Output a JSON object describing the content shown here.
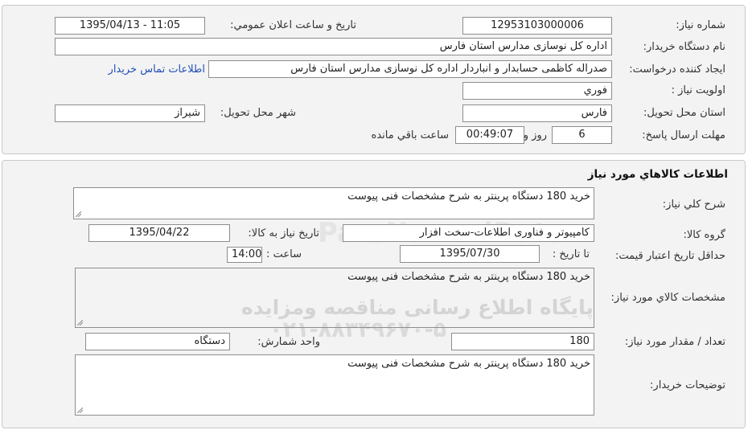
{
  "header_info": {
    "need_number_label": "شماره نياز:",
    "need_number": "12953103000006",
    "announce_datetime_label": "تاريخ و ساعت اعلان عمومي:",
    "announce_datetime": "1395/04/13 - 11:05",
    "buyer_org_label": "نام دستگاه خريدار:",
    "buyer_org": "اداره کل نوسازی مدارس استان فارس",
    "requester_label": "ايجاد کننده درخواست:",
    "requester": "صدراله  کاظمی حسابدار و انباردار اداره کل نوسازی مدارس استان فارس",
    "buyer_contact_link": "اطلاعات تماس خريدار",
    "priority_label": "اولويت نياز :",
    "priority": "فوري",
    "province_label": "استان محل تحويل:",
    "province": "فارس",
    "city_label": "شهر محل تحويل:",
    "city": "شيراز",
    "deadline_label": "مهلت ارسال پاسخ:",
    "deadline_days": "6",
    "days_and_label": "روز و",
    "deadline_time": "00:49:07",
    "remaining_label": "ساعت باقي مانده"
  },
  "goods": {
    "section_title": "اطلاعات کالاهاي مورد نياز",
    "general_desc_label": "شرح کلي نياز:",
    "general_desc": "خرید 180 دستگاه پرینتر به شرح مشخصات فنی پیوست",
    "goods_group_label": "گروه کالا:",
    "goods_group": "کامپیوتر و فناوری اطلاعات-سخت افزار",
    "need_date_label": "تاريخ نياز به کالا:",
    "need_date": "1395/04/22",
    "price_validity_label": "حداقل تاريخ اعتبار قيمت:",
    "until_date_label": "تا تاريخ :",
    "until_date": "1395/07/30",
    "time_label": "ساعت :",
    "time_value": "14:00",
    "specs_label": "مشخصات کالاي مورد نياز:",
    "specs": "خرید 180 دستگاه پرینتر به شرح مشخصات فنی پیوست",
    "quantity_label": "تعداد / مقدار مورد نياز:",
    "quantity": "180",
    "unit_label": "واحد شمارش:",
    "unit": "دستگاه",
    "buyer_notes_label": "توضيحات خريدار:",
    "buyer_notes": "خرید 180 دستگاه پرینتر به شرح مشخصات فنی پیوست"
  },
  "watermark": {
    "line1": "پایگاه اطلاع رسانی مناقصه ومزایده",
    "line2": "۰۲۱-۸۸۳۴۹۶۷۰-۵",
    "latin": "ParsNamadData"
  }
}
